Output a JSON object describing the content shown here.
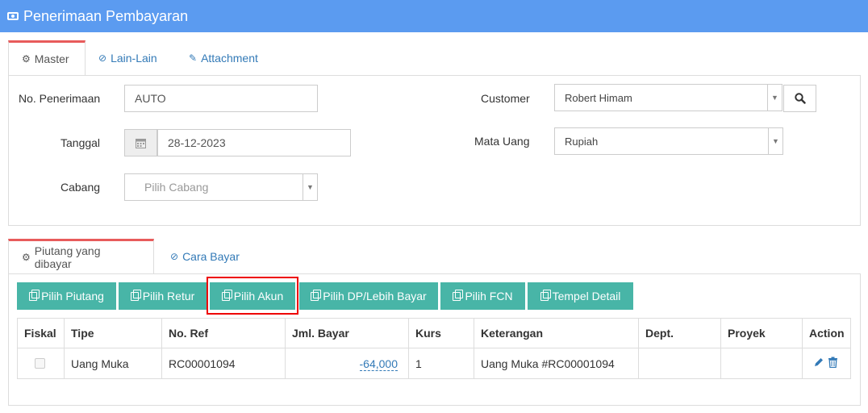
{
  "header": {
    "title": "Penerimaan Pembayaran",
    "icon": "money-icon"
  },
  "top_tabs": [
    {
      "label": "Master",
      "icon": "cogs-icon"
    },
    {
      "label": "Lain-Lain",
      "icon": "check-circle-icon"
    },
    {
      "label": "Attachment",
      "icon": "paperclip-icon"
    }
  ],
  "form": {
    "no_penerimaan_label": "No. Penerimaan",
    "no_penerimaan_value": "AUTO",
    "tanggal_label": "Tanggal",
    "tanggal_value": "28-12-2023",
    "cabang_label": "Cabang",
    "cabang_placeholder": "Pilih Cabang",
    "customer_label": "Customer",
    "customer_value": "Robert Himam",
    "mata_uang_label": "Mata Uang",
    "mata_uang_value": "Rupiah"
  },
  "detail_tabs": [
    {
      "label": "Piutang yang dibayar",
      "icon": "cogs-icon"
    },
    {
      "label": "Cara Bayar",
      "icon": "check-circle-icon"
    }
  ],
  "toolbar": {
    "pilih_piutang": "Pilih Piutang",
    "pilih_retur": "Pilih Retur",
    "pilih_akun": "Pilih Akun",
    "pilih_dp": "Pilih DP/Lebih Bayar",
    "pilih_fcn": "Pilih FCN",
    "tempel_detail": "Tempel Detail"
  },
  "table": {
    "columns": [
      "Fiskal",
      "Tipe",
      "No. Ref",
      "Jml. Bayar",
      "Kurs",
      "Keterangan",
      "Dept.",
      "Proyek",
      "Action"
    ],
    "rows": [
      {
        "tipe": "Uang Muka",
        "no_ref": "RC00001094",
        "jml_bayar": "-64,000",
        "kurs": "1",
        "keterangan": "Uang Muka #RC00001094",
        "dept": "",
        "proyek": ""
      }
    ]
  },
  "colors": {
    "header_bg": "#5b9bf0",
    "button_bg": "#48b5a7",
    "active_tab_top": "#e85b5b",
    "link": "#337ab7",
    "highlight": "#e00000"
  }
}
